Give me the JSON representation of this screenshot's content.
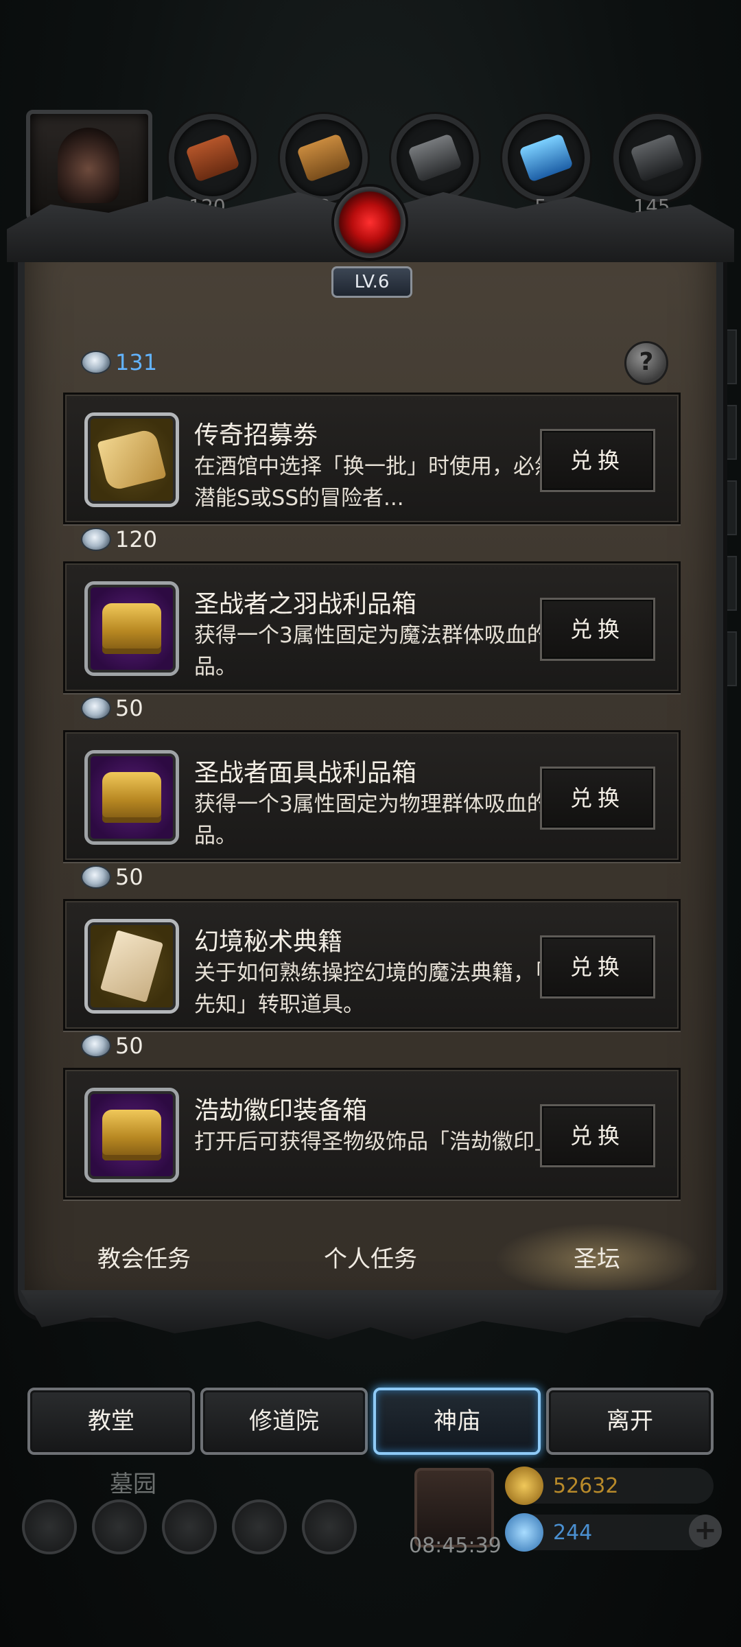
{
  "resources": {
    "counts": [
      "120",
      "53",
      "21",
      "5",
      "145"
    ]
  },
  "panel": {
    "level": "LV.6",
    "help_glyph": "?",
    "items": [
      {
        "cost": "131",
        "title": "传奇招募劵",
        "desc": "在酒馆中选择「换一批」时使用，必然会有潜能S或SS的冒险者...",
        "button": "兑换",
        "icon": "scroll-icon"
      },
      {
        "cost": "120",
        "title": "圣战者之羽战利品箱",
        "desc": "获得一个3属性固定为魔法群体吸血的战利品。",
        "button": "兑换",
        "icon": "chest-icon"
      },
      {
        "cost": "50",
        "title": "圣战者面具战利品箱",
        "desc": "获得一个3属性固定为物理群体吸血的战利品。",
        "button": "兑换",
        "icon": "chest-icon"
      },
      {
        "cost": "50",
        "title": "幻境秘术典籍",
        "desc": "关于如何熟练操控幻境的魔法典籍，「幻境先知」转职道具。",
        "button": "兑换",
        "icon": "page-icon"
      },
      {
        "cost": "50",
        "title": "浩劫徽印装备箱",
        "desc": "打开后可获得圣物级饰品「浩劫徽印」。",
        "button": "兑换",
        "icon": "chest-icon"
      }
    ],
    "tabs": [
      "教会任务",
      "个人任务",
      "圣坛"
    ],
    "active_tab": "圣坛"
  },
  "nav": {
    "buttons": [
      "教堂",
      "修道院",
      "神庙",
      "离开"
    ],
    "active": "神庙"
  },
  "bottom": {
    "map_label": "墓园",
    "timer": "08:45:39",
    "gold": "52632",
    "gems": "244",
    "plus": "+"
  },
  "colors": {
    "cost_highlight": "#62b3ff",
    "active_nav_glow": "#8ecaf6",
    "panel": "#3d362e"
  }
}
